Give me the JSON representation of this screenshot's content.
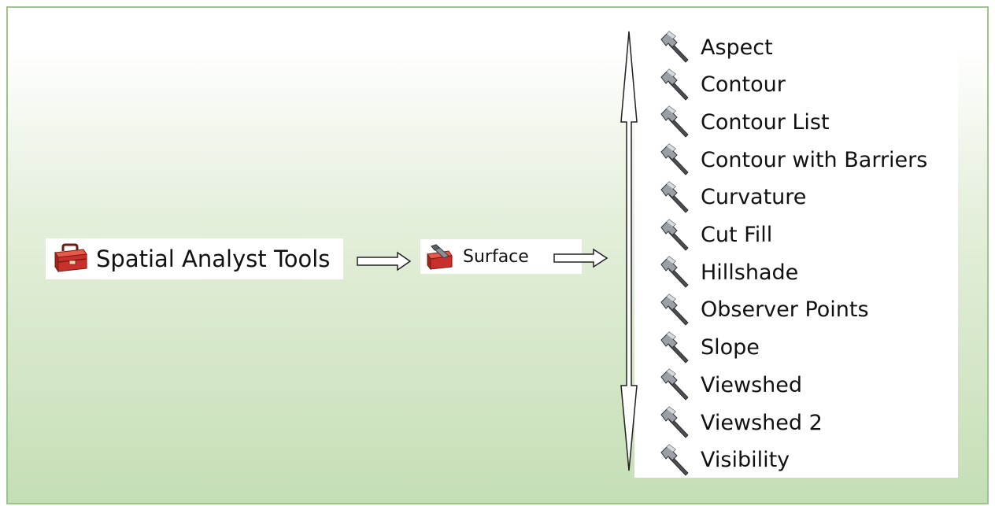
{
  "toolbox": {
    "label": "Spatial Analyst Tools",
    "icon": "red-toolbox-icon"
  },
  "toolset": {
    "label": "Surface",
    "icon": "toolset-icon"
  },
  "tools": [
    {
      "label": "Aspect",
      "icon": "hammer-icon"
    },
    {
      "label": "Contour",
      "icon": "hammer-icon"
    },
    {
      "label": "Contour List",
      "icon": "hammer-icon"
    },
    {
      "label": "Contour with Barriers",
      "icon": "hammer-icon"
    },
    {
      "label": "Curvature",
      "icon": "hammer-icon"
    },
    {
      "label": "Cut Fill",
      "icon": "hammer-icon"
    },
    {
      "label": "Hillshade",
      "icon": "hammer-icon"
    },
    {
      "label": "Observer Points",
      "icon": "hammer-icon"
    },
    {
      "label": "Slope",
      "icon": "hammer-icon"
    },
    {
      "label": "Viewshed",
      "icon": "hammer-icon"
    },
    {
      "label": "Viewshed 2",
      "icon": "hammer-icon"
    },
    {
      "label": "Visibility",
      "icon": "hammer-icon"
    }
  ],
  "colors": {
    "frame_border": "#9cc48c",
    "gradient_bottom": "#c5deb5",
    "toolbox_red": "#c9302c"
  }
}
